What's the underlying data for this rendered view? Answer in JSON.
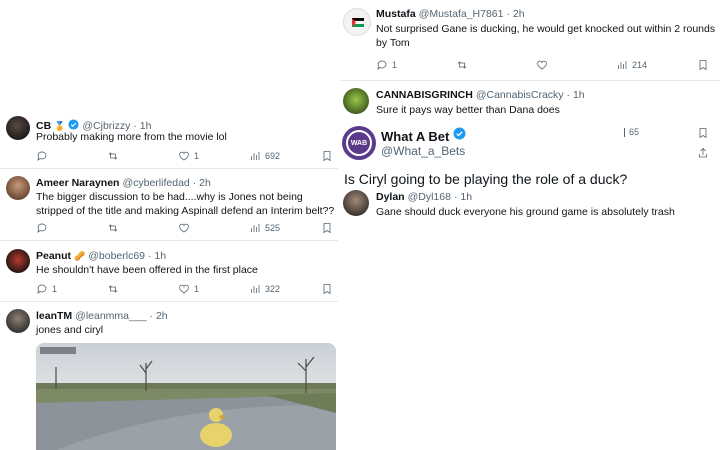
{
  "left_feed": {
    "cb": {
      "name": "CB",
      "handle": "@Cjbrizzy",
      "time": "· 1h",
      "text": "Probably making more from the movie lol",
      "likes": "1",
      "views": "692"
    },
    "ameer": {
      "name": "Ameer Naraynen",
      "handle": "@cyberlifedad",
      "time": "· 2h",
      "text": "The bigger discussion to be had....why is Jones not being stripped of the title and making Aspinall defend an Interim belt??",
      "views": "525"
    },
    "peanut": {
      "name": "Peanut",
      "handle": "@boberlc69",
      "time": "· 1h",
      "text": "He shouldn't have been offered in the first place",
      "replies": "1",
      "likes": "1",
      "views": "322"
    },
    "lean": {
      "name": "leanTM",
      "handle": "@leanmma___",
      "time": "· 2h",
      "text": "jones and ciryl"
    }
  },
  "right_feed": {
    "mustafa": {
      "name": "Mustafa",
      "handle": "@Mustafa_H7861",
      "time": "· 2h",
      "text": "Not surprised Gane is ducking, he would get knocked out within 2 rounds by Tom",
      "replies": "1",
      "views": "214"
    },
    "grinch": {
      "name": "CANNABISGRINCH",
      "handle": "@CannabisCracky",
      "time": "· 1h",
      "text": "Sure it pays way better than Dana does"
    },
    "wab": {
      "name": "What A Bet",
      "handle": "@What_a_Bets",
      "views": "65",
      "avatar_label": "WAB",
      "text": "Is Ciryl going to be playing the role of a duck?"
    },
    "dylan": {
      "name": "Dylan",
      "handle": "@Dyl168",
      "time": "· 1h",
      "text": "Gane should duck everyone his ground game is absolutely trash"
    }
  },
  "colors": {
    "verified": "#1d9bf0",
    "text_secondary": "#536471",
    "divider": "#e6e9ec"
  }
}
